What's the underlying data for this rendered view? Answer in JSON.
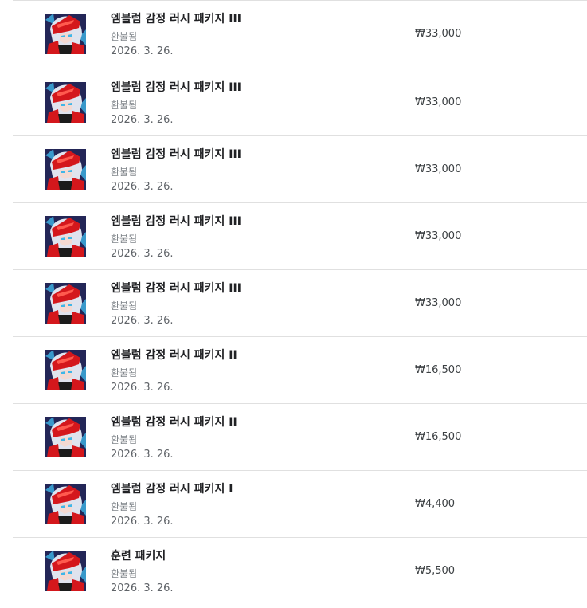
{
  "purchases": [
    {
      "title": "엠블럼 감정 러시 패키지 III",
      "status": "환불됨",
      "date": "2026. 3. 26.",
      "price": "₩33,000",
      "icon": "game-character-icon"
    },
    {
      "title": "엠블럼 감정 러시 패키지 III",
      "status": "환불됨",
      "date": "2026. 3. 26.",
      "price": "₩33,000",
      "icon": "game-character-icon"
    },
    {
      "title": "엠블럼 감정 러시 패키지 III",
      "status": "환불됨",
      "date": "2026. 3. 26.",
      "price": "₩33,000",
      "icon": "game-character-icon"
    },
    {
      "title": "엠블럼 감정 러시 패키지 III",
      "status": "환불됨",
      "date": "2026. 3. 26.",
      "price": "₩33,000",
      "icon": "game-character-icon"
    },
    {
      "title": "엠블럼 감정 러시 패키지 III",
      "status": "환불됨",
      "date": "2026. 3. 26.",
      "price": "₩33,000",
      "icon": "game-character-icon"
    },
    {
      "title": "엠블럼 감정 러시 패키지 II",
      "status": "환불됨",
      "date": "2026. 3. 26.",
      "price": "₩16,500",
      "icon": "game-character-icon"
    },
    {
      "title": "엠블럼 감정 러시 패키지 II",
      "status": "환불됨",
      "date": "2026. 3. 26.",
      "price": "₩16,500",
      "icon": "game-character-icon"
    },
    {
      "title": "엠블럼 감정 러시 패키지 I",
      "status": "환불됨",
      "date": "2026. 3. 26.",
      "price": "₩4,400",
      "icon": "game-character-icon"
    },
    {
      "title": "훈련 패키지",
      "status": "환불됨",
      "date": "2026. 3. 26.",
      "price": "₩5,500",
      "icon": "game-character-icon"
    }
  ],
  "colors": {
    "divider": "#e0e0e0",
    "title": "#202124",
    "status": "#80868b",
    "date": "#5f6368",
    "price": "#3c4043",
    "icon_red": "#d4171c",
    "icon_dark": "#1a1a3a",
    "icon_hair": "#dfe3ee",
    "icon_cyan": "#3fb6e8"
  }
}
